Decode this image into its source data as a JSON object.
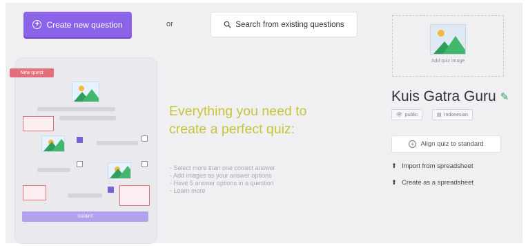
{
  "toolbar": {
    "create_label": "Create new question",
    "or_label": "or",
    "search_label": "Search from existing questions"
  },
  "preview": {
    "tag_label": "New quest",
    "submit_label": "SUBMIT"
  },
  "promo": {
    "title": "Everything you need to create a perfect quiz:",
    "items": [
      "- Select more than one correct answer",
      "- Add images as your answer options",
      "- Have 5 answer options in a question",
      "- Learn more"
    ]
  },
  "quiz": {
    "image_label": "Add quiz image",
    "title": "Kuis Gatra Guru",
    "visibility_tag": "public",
    "language_tag": "Indonesian",
    "align_label": "Align quiz to standard",
    "import_label": "Import from spreadsheet",
    "create_label": "Create as a spreadsheet"
  },
  "colors": {
    "accent": "#8a63e8",
    "promo_text": "#c5c53a",
    "edit_icon": "#2fa05c"
  }
}
